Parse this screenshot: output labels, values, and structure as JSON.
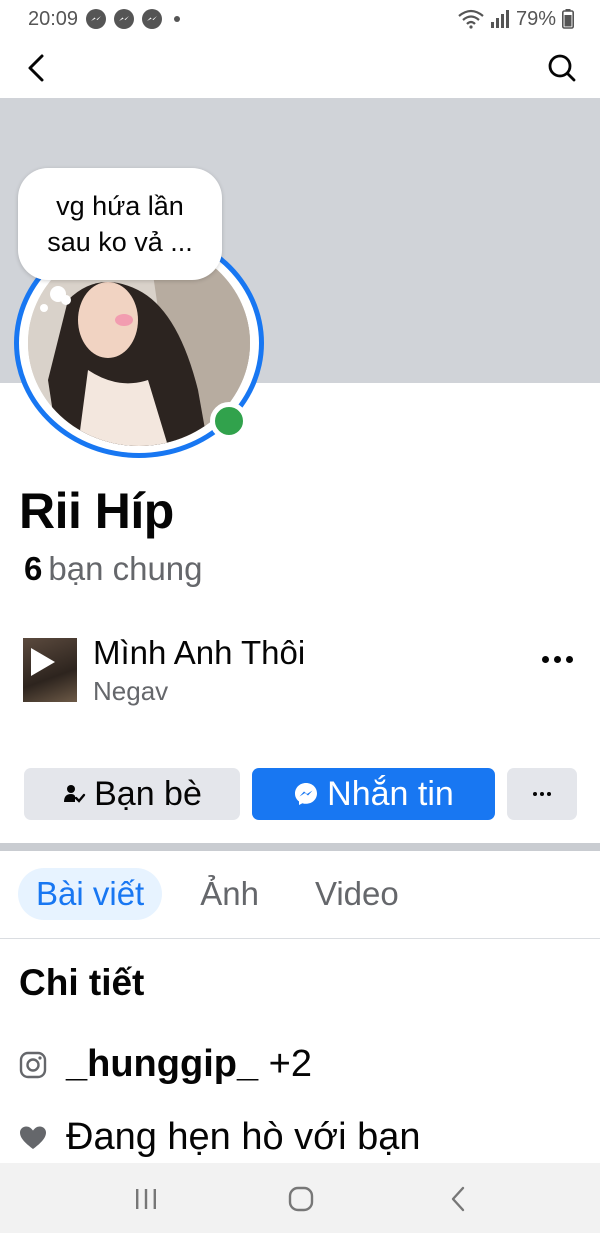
{
  "status_bar": {
    "time": "20:09",
    "battery": "79%"
  },
  "profile": {
    "name": "Rii Híp",
    "note": "vg hứa lần sau ko vả ...",
    "mutual_count": "6",
    "mutual_label": "bạn chung",
    "online_color": "#31a24c"
  },
  "music": {
    "title": "Mình Anh Thôi",
    "artist": "Negav"
  },
  "actions": {
    "friends_label": "Bạn bè",
    "message_label": "Nhắn tin",
    "accent": "#1877f2"
  },
  "tabs": [
    {
      "label": "Bài viết",
      "active": true
    },
    {
      "label": "Ảnh",
      "active": false
    },
    {
      "label": "Video",
      "active": false
    }
  ],
  "details": {
    "title": "Chi tiết",
    "instagram_handle": "_hunggip_",
    "instagram_extra": "+2",
    "relationship": "Đang hẹn hò với bạn"
  },
  "icons": {
    "back": "chevron-left-icon",
    "search": "search-icon",
    "instagram": "instagram-icon",
    "relationship": "heart-icon"
  }
}
